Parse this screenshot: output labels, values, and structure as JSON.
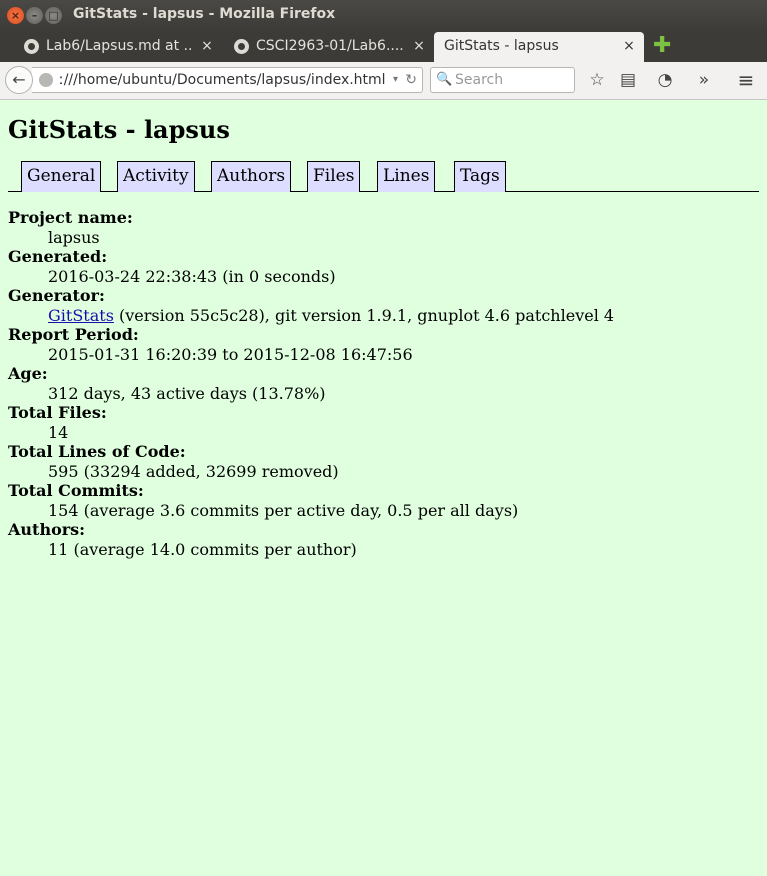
{
  "window": {
    "title": "GitStats - lapsus - Mozilla Firefox",
    "close_glyph": "×",
    "min_glyph": "–",
    "max_glyph": "□"
  },
  "tabs": [
    {
      "label": "Lab6/Lapsus.md at ...",
      "icon": "github-icon"
    },
    {
      "label": "CSCI2963-01/Lab6....",
      "icon": "github-icon"
    },
    {
      "label": "GitStats - lapsus",
      "active": true
    }
  ],
  "tab_close_glyph": "×",
  "new_tab_glyph": "✚",
  "navbar": {
    "back_glyph": "←",
    "url": "ː///home/ubuntu/Documents/lapsus/index.html",
    "url_drop_glyph": "▾",
    "reload_glyph": "↻",
    "search_placeholder": "Search",
    "search_icon_glyph": "🔍",
    "bookmark_glyph": "☆",
    "reader_glyph": "▤",
    "pocket_glyph": "◔",
    "overflow_glyph": "»",
    "menu_glyph": "≡"
  },
  "page": {
    "heading": "GitStats - lapsus",
    "nav": [
      "General",
      "Activity",
      "Authors",
      "Files",
      "Lines",
      "Tags"
    ],
    "info": [
      {
        "label": "Project name:",
        "value": "lapsus"
      },
      {
        "label": "Generated:",
        "value": "2016-03-24 22:38:43 (in 0 seconds)"
      },
      {
        "label": "Generator:",
        "link": "GitStats",
        "value": " (version 55c5c28), git version 1.9.1, gnuplot 4.6 patchlevel 4"
      },
      {
        "label": "Report Period:",
        "value": "2015-01-31 16:20:39 to 2015-12-08 16:47:56"
      },
      {
        "label": "Age:",
        "value": "312 days, 43 active days (13.78%)"
      },
      {
        "label": "Total Files:",
        "value": "14"
      },
      {
        "label": "Total Lines of Code:",
        "value": "595 (33294 added, 32699 removed)"
      },
      {
        "label": "Total Commits:",
        "value": "154 (average 3.6 commits per active day, 0.5 per all days)"
      },
      {
        "label": "Authors:",
        "value": "11 (average 14.0 commits per author)"
      }
    ]
  },
  "colors": {
    "page_background": "#dfffdf",
    "nav_tab_background": "#ddddff",
    "link": "#1a0dab"
  }
}
